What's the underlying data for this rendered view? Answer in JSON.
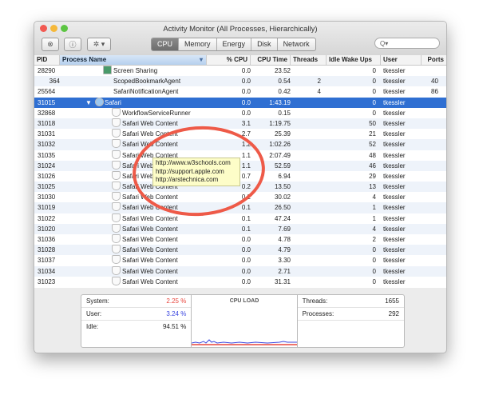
{
  "window": {
    "title": "Activity Monitor (All Processes, Hierarchically)"
  },
  "toolbar": {
    "stop_icon": "stop-process-icon",
    "info_icon": "info-icon",
    "gear_label": "✲ ▾",
    "tabs": [
      "CPU",
      "Memory",
      "Energy",
      "Disk",
      "Network"
    ],
    "active_tab": "CPU",
    "search_placeholder": "Q▾"
  },
  "columns": [
    "PID",
    "Process Name",
    "% CPU",
    "CPU Time",
    "Threads",
    "Idle Wake Ups",
    "User",
    "Ports"
  ],
  "rows": [
    {
      "pid": "28290",
      "name": "Screen Sharing",
      "cpu": "0.0",
      "time": "23.52",
      "threads": "",
      "wake": "0",
      "user": "tkessler",
      "ports": "",
      "level": 1
    },
    {
      "pid": "364",
      "name": "ScopedBookmarkAgent",
      "cpu": "0.0",
      "time": "0.54",
      "threads": "2",
      "wake": "0",
      "user": "tkessler",
      "ports": "40",
      "level": 1
    },
    {
      "pid": "25564",
      "name": "SafariNotificationAgent",
      "cpu": "0.0",
      "time": "0.42",
      "threads": "4",
      "wake": "0",
      "user": "tkessler",
      "ports": "86",
      "level": 1
    },
    {
      "pid": "31015",
      "name": "Safari",
      "cpu": "0.0",
      "time": "1:43.19",
      "threads": "",
      "wake": "0",
      "user": "tkessler",
      "ports": "",
      "level": 0,
      "selected": true
    },
    {
      "pid": "32868",
      "name": "WorkflowServiceRunner",
      "cpu": "0.0",
      "time": "0.15",
      "threads": "",
      "wake": "0",
      "user": "tkessler",
      "ports": "",
      "level": 2
    },
    {
      "pid": "31018",
      "name": "Safari Web Content",
      "cpu": "3.1",
      "time": "1:19.75",
      "threads": "",
      "wake": "50",
      "user": "tkessler",
      "ports": "",
      "level": 2
    },
    {
      "pid": "31031",
      "name": "Safari Web Content",
      "cpu": "2.7",
      "time": "25.39",
      "threads": "",
      "wake": "21",
      "user": "tkessler",
      "ports": "",
      "level": 2
    },
    {
      "pid": "31032",
      "name": "Safari Web Content",
      "cpu": "1.2",
      "time": "1:02.26",
      "threads": "",
      "wake": "52",
      "user": "tkessler",
      "ports": "",
      "level": 2
    },
    {
      "pid": "31035",
      "name": "Safari Web Content",
      "cpu": "1.1",
      "time": "2:07.49",
      "threads": "",
      "wake": "48",
      "user": "tkessler",
      "ports": "",
      "level": 2
    },
    {
      "pid": "31024",
      "name": "Safari Web Content",
      "cpu": "1.1",
      "time": "52.59",
      "threads": "",
      "wake": "46",
      "user": "tkessler",
      "ports": "",
      "level": 2
    },
    {
      "pid": "31026",
      "name": "Safari Web Content",
      "cpu": "0.7",
      "time": "6.94",
      "threads": "",
      "wake": "29",
      "user": "tkessler",
      "ports": "",
      "level": 2
    },
    {
      "pid": "31025",
      "name": "Safari Web Content",
      "cpu": "0.2",
      "time": "13.50",
      "threads": "",
      "wake": "13",
      "user": "tkessler",
      "ports": "",
      "level": 2
    },
    {
      "pid": "31030",
      "name": "Safari Web Content",
      "cpu": "0.2",
      "time": "30.02",
      "threads": "",
      "wake": "4",
      "user": "tkessler",
      "ports": "",
      "level": 2
    },
    {
      "pid": "31019",
      "name": "Safari Web Content",
      "cpu": "0.1",
      "time": "26.50",
      "threads": "",
      "wake": "1",
      "user": "tkessler",
      "ports": "",
      "level": 2
    },
    {
      "pid": "31022",
      "name": "Safari Web Content",
      "cpu": "0.1",
      "time": "47.24",
      "threads": "",
      "wake": "1",
      "user": "tkessler",
      "ports": "",
      "level": 2
    },
    {
      "pid": "31020",
      "name": "Safari Web Content",
      "cpu": "0.1",
      "time": "7.69",
      "threads": "",
      "wake": "4",
      "user": "tkessler",
      "ports": "",
      "level": 2
    },
    {
      "pid": "31036",
      "name": "Safari Web Content",
      "cpu": "0.0",
      "time": "4.78",
      "threads": "",
      "wake": "2",
      "user": "tkessler",
      "ports": "",
      "level": 2
    },
    {
      "pid": "31028",
      "name": "Safari Web Content",
      "cpu": "0.0",
      "time": "4.79",
      "threads": "",
      "wake": "0",
      "user": "tkessler",
      "ports": "",
      "level": 2
    },
    {
      "pid": "31037",
      "name": "Safari Web Content",
      "cpu": "0.0",
      "time": "3.30",
      "threads": "",
      "wake": "0",
      "user": "tkessler",
      "ports": "",
      "level": 2
    },
    {
      "pid": "31034",
      "name": "Safari Web Content",
      "cpu": "0.0",
      "time": "2.71",
      "threads": "",
      "wake": "0",
      "user": "tkessler",
      "ports": "",
      "level": 2
    },
    {
      "pid": "31023",
      "name": "Safari Web Content",
      "cpu": "0.0",
      "time": "31.31",
      "threads": "",
      "wake": "0",
      "user": "tkessler",
      "ports": "",
      "level": 2
    }
  ],
  "tooltip": [
    "http://www.w3schools.com",
    "http://support.apple.com",
    "http://arstechnica.com"
  ],
  "summary": {
    "system_label": "System:",
    "system_value": "2.25 %",
    "user_label": "User:",
    "user_value": "3.24 %",
    "idle_label": "Idle:",
    "idle_value": "94.51 %",
    "cpu_load_title": "CPU LOAD",
    "threads_label": "Threads:",
    "threads_value": "1655",
    "processes_label": "Processes:",
    "processes_value": "292",
    "colors": {
      "system": "#e8453c",
      "user": "#3b47e0"
    }
  }
}
